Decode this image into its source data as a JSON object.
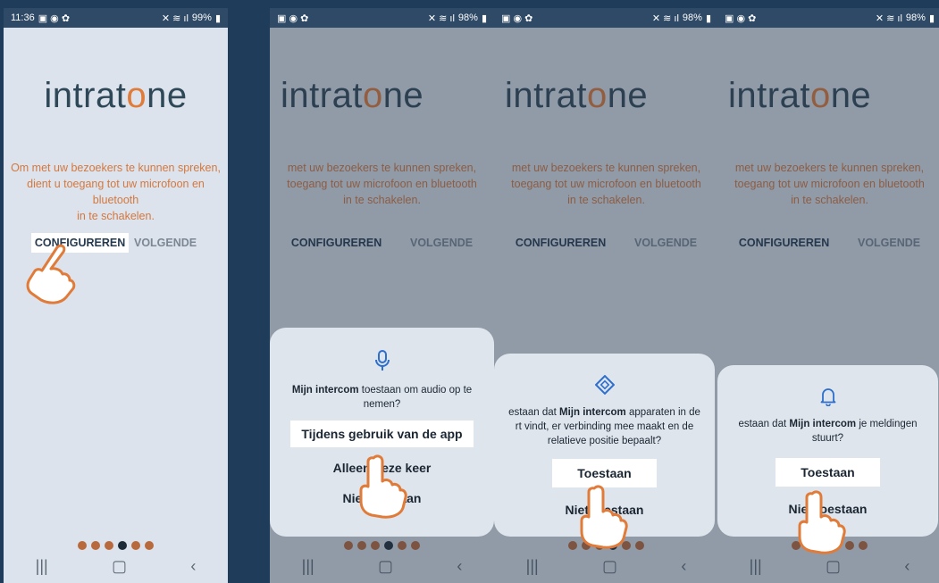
{
  "phones": [
    {
      "status": {
        "time": "11:36",
        "battery": "99%"
      },
      "logo": {
        "prefix": "intrat",
        "o": "o",
        "suffix": "ne"
      },
      "message": "Om met uw bezoekers te kunnen spreken,\ndient u toegang tot uw microfoon en bluetooth\nin te schakelen.",
      "configure_label": "CONFIGUREREN",
      "next_label": "VOLGENDE"
    },
    {
      "status": {
        "time": "",
        "battery": "98%"
      },
      "logo": {
        "prefix": "intrat",
        "o": "o",
        "suffix": "ne"
      },
      "message": "met uw bezoekers te kunnen spreken,\ntoegang tot uw microfoon en bluetooth\nin te schakelen.",
      "configure_label": "CONFIGUREREN",
      "next_label": "VOLGENDE",
      "dialog": {
        "app_name": "Mijn intercom",
        "text": " toestaan om audio op te nemen?",
        "options": [
          "Tijdens gebruik van de app",
          "Alleen deze keer",
          "Niet toestaan"
        ]
      }
    },
    {
      "status": {
        "time": "",
        "battery": "98%"
      },
      "logo": {
        "prefix": "intrat",
        "o": "o",
        "suffix": "ne"
      },
      "message": "met uw bezoekers te kunnen spreken,\ntoegang tot uw microfoon en bluetooth\nin te schakelen.",
      "configure_label": "CONFIGUREREN",
      "next_label": "VOLGENDE",
      "dialog": {
        "prefix": "estaan dat ",
        "app_name": "Mijn intercom",
        "text": " apparaten in de\nrt vindt, er verbinding mee maakt en de\nrelatieve positie bepaalt?",
        "options": [
          "Toestaan",
          "Niet toestaan"
        ]
      }
    },
    {
      "status": {
        "time": "",
        "battery": "98%"
      },
      "logo": {
        "prefix": "intrat",
        "o": "o",
        "suffix": "ne"
      },
      "message": "met uw bezoekers te kunnen spreken,\ntoegang tot uw microfoon en bluetooth\nin te schakelen.",
      "configure_label": "CONFIGUREREN",
      "next_label": "VOLGENDE",
      "dialog": {
        "prefix": "estaan dat ",
        "app_name": "Mijn intercom",
        "text": " je meldingen\nstuurt?",
        "options": [
          "Toestaan",
          "Niet toestaan"
        ]
      }
    }
  ],
  "colors": {
    "accent": "#e07b39",
    "frame": "#1f3d5a",
    "dot": "#b86a3c"
  },
  "icons": [
    "microphone-icon",
    "bluetooth-diamond-icon",
    "bell-icon",
    "hand-pointer-icon"
  ]
}
